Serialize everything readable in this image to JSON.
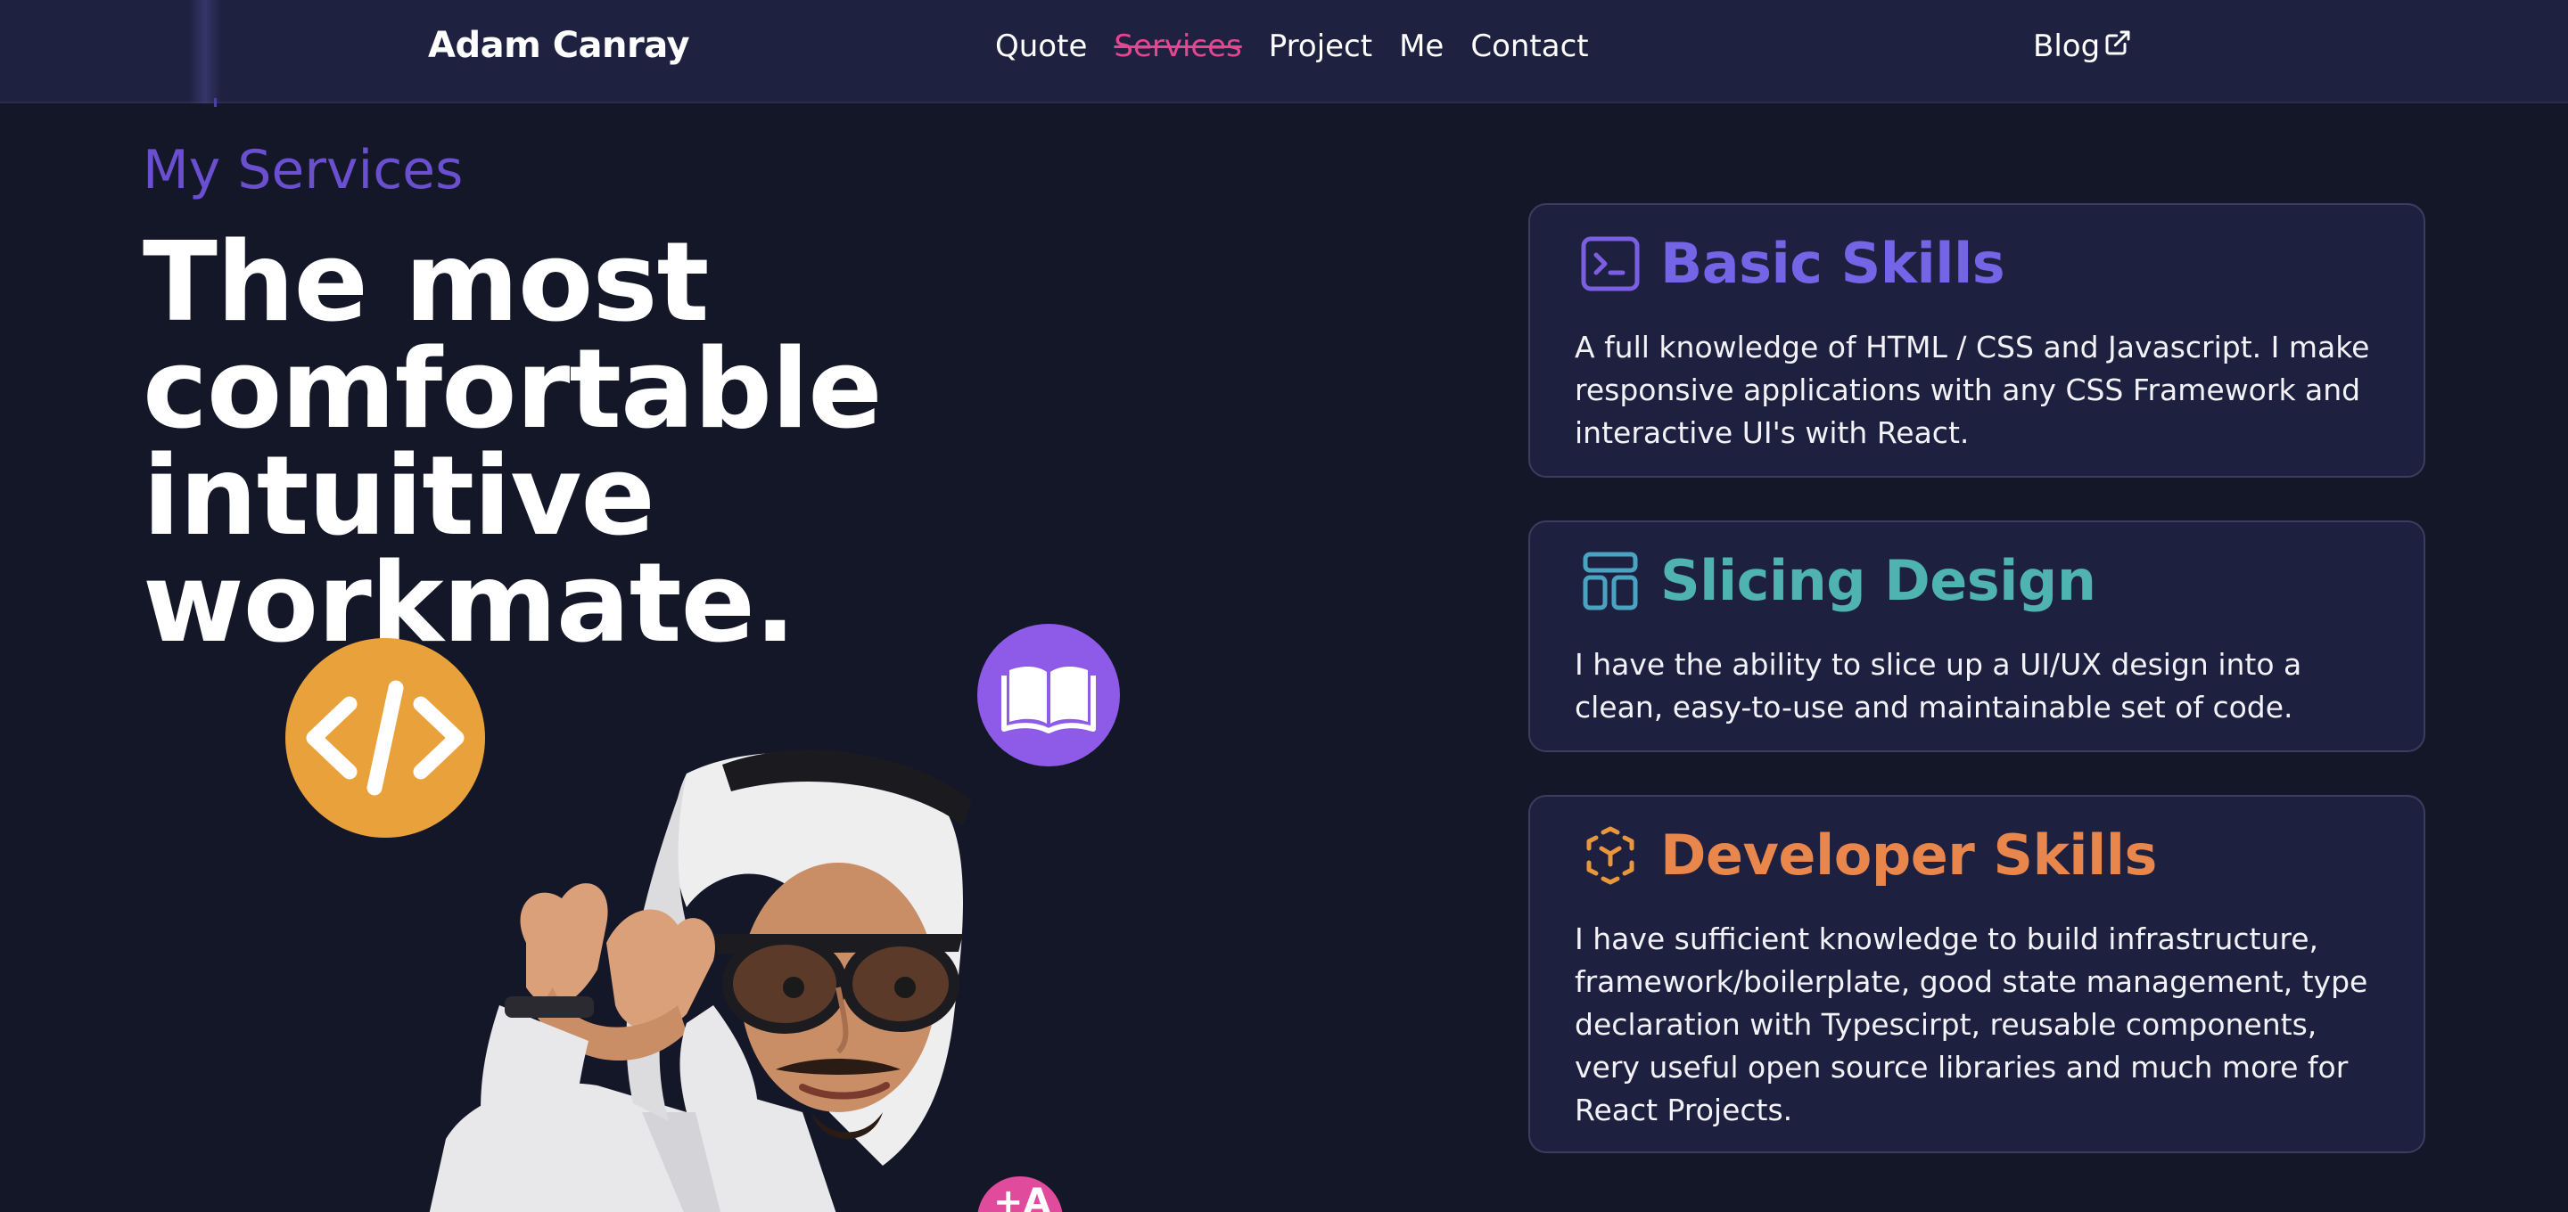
{
  "navbar": {
    "brand": "Adam Canray",
    "links": [
      {
        "label": "Quote"
      },
      {
        "label": "Services"
      },
      {
        "label": "Project"
      },
      {
        "label": "Me"
      },
      {
        "label": "Contact"
      }
    ],
    "active_link": "Services",
    "blog_label": "Blog",
    "blog_icon": "external-link-icon"
  },
  "hero": {
    "kicker": "My Services",
    "headline_lines": [
      "The most",
      "comfortable",
      "intuitive workmate."
    ],
    "floating_icons": [
      "code-icon",
      "book-open-icon",
      "translate-icon"
    ]
  },
  "cards": [
    {
      "icon": "terminal-icon",
      "title": "Basic Skills",
      "description": "A full knowledge of HTML / CSS and Javascript. I make responsive applications with any CSS Framework and interactive UI's with React."
    },
    {
      "icon": "layout-icon",
      "title": "Slicing Design",
      "description": "I have the ability to slice up a UI/UX design into a clean, easy-to-use and maintainable set of code."
    },
    {
      "icon": "cube-icon",
      "title": "Developer Skills",
      "description": "I have sufficient knowledge to build infrastructure, framework/boilerplate, good state management, type declaration with Typescirpt, reusable components, very useful open source libraries and much more for React Projects."
    }
  ],
  "colors": {
    "background": "#141727",
    "navbar": "#1f2140",
    "accent_purple": "#6a4fd1",
    "active_link": "#e2478f",
    "card_bg": "#1e2040",
    "basic_skills": "#7464e6",
    "slicing_design": "#4fb3b0",
    "developer_skills": "#e8864c",
    "code_bubble": "#e9a23b",
    "book_bubble": "#8e5be8",
    "translate_bubble": "#e14b9b"
  }
}
